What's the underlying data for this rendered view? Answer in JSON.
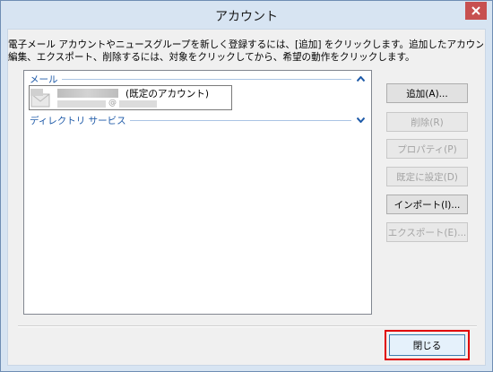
{
  "window": {
    "title": "アカウント"
  },
  "description": {
    "line1": "電子メール アカウントやニュースグループを新しく登録するには、[追加] をクリックします。追加したアカウントやニュースグループを",
    "line2": "編集、エクスポート、削除するには、対象をクリックしてから、希望の動作をクリックします。"
  },
  "account_list": {
    "groups": [
      {
        "label": "メール",
        "chevron": "chevron-up-icon"
      },
      {
        "label": "ディレクトリ サービス",
        "chevron": "chevron-down-icon"
      }
    ],
    "items": [
      {
        "name_suffix": "(既定のアカウント)",
        "at_symbol": "@",
        "icon": "mail-envelope-icon"
      }
    ]
  },
  "buttons": {
    "add": {
      "label": "追加(A)...",
      "enabled": true
    },
    "remove": {
      "label": "削除(R)",
      "enabled": false
    },
    "properties": {
      "label": "プロパティ(P)",
      "enabled": false
    },
    "set_default": {
      "label": "既定に設定(D)",
      "enabled": false
    },
    "import": {
      "label": "インポート(I)...",
      "enabled": true
    },
    "export": {
      "label": "エクスポート(E)...",
      "enabled": false
    },
    "close": {
      "label": "閉じる",
      "enabled": true
    }
  },
  "colors": {
    "group_header": "#1e5aa8",
    "highlight_border": "#e00000",
    "window_frame": "#d7e4f2"
  }
}
